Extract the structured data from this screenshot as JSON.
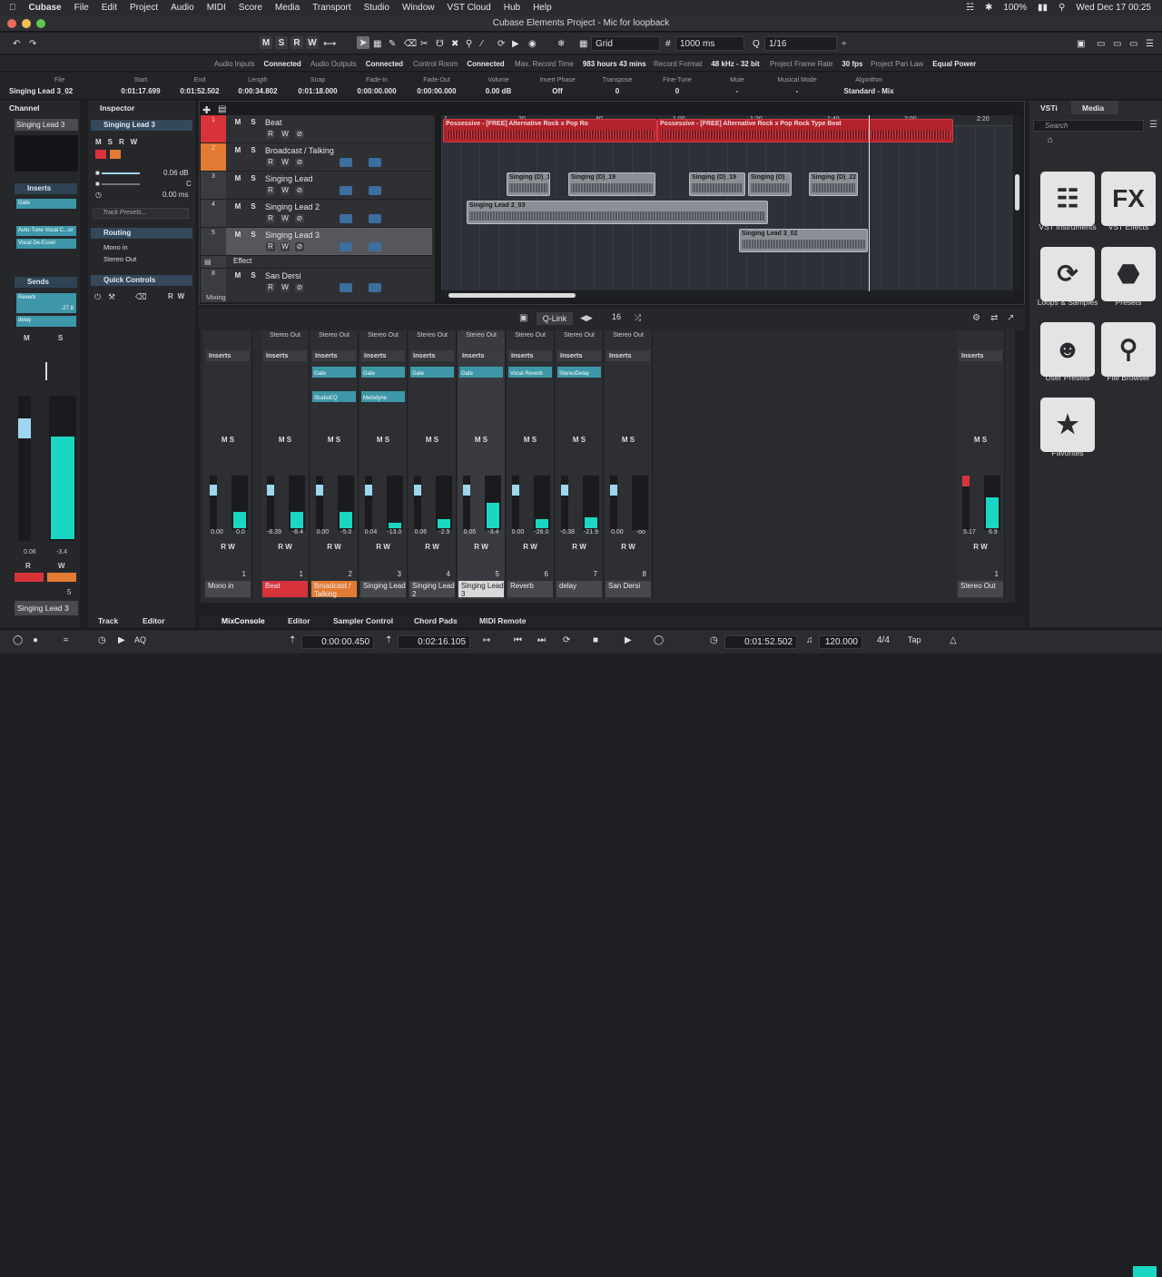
{
  "menubar": {
    "app": "Cubase",
    "items": [
      "File",
      "Edit",
      "Project",
      "Audio",
      "MIDI",
      "Score",
      "Media",
      "Transport",
      "Studio",
      "Window",
      "VST Cloud",
      "Hub",
      "Help"
    ],
    "battery": "100%",
    "clock": "Wed Dec 17  00:25"
  },
  "window": {
    "title": "Cubase Elements Project - Mic for loopback"
  },
  "toolbar": {
    "m": "M",
    "s": "S",
    "r": "R",
    "w": "W",
    "snap_type": "Grid",
    "grid_value": "1000 ms",
    "quantize": "1/16"
  },
  "status": [
    {
      "label": "Audio Inputs",
      "value": "Connected"
    },
    {
      "label": "Audio Outputs",
      "value": "Connected"
    },
    {
      "label": "Control Room",
      "value": "Connected"
    },
    {
      "label": "Max. Record Time",
      "value": "983 hours 43 mins"
    },
    {
      "label": "Record Format",
      "value": "48 kHz - 32 bit"
    },
    {
      "label": "Project Frame Rate",
      "value": "30 fps"
    },
    {
      "label": "Project Pan Law",
      "value": "Equal Power"
    }
  ],
  "info": {
    "file_label": "File",
    "file": "Singing Lead 3_02",
    "cols": [
      {
        "label": "Start",
        "value": "0:01:17.699"
      },
      {
        "label": "End",
        "value": "0:01:52.502"
      },
      {
        "label": "Length",
        "value": "0:00:34.802"
      },
      {
        "label": "Snap",
        "value": "0:01:18.000"
      },
      {
        "label": "Fade-In",
        "value": "0:00:00.000"
      },
      {
        "label": "Fade-Out",
        "value": "0:00:00.000"
      },
      {
        "label": "Volume",
        "value": "0.00     dB"
      },
      {
        "label": "Invert Phase",
        "value": "Off"
      },
      {
        "label": "Transpose",
        "value": "0"
      },
      {
        "label": "Fine-Tune",
        "value": "0"
      },
      {
        "label": "Mute",
        "value": "-"
      },
      {
        "label": "Musical Mode",
        "value": "-"
      },
      {
        "label": "Algorithm",
        "value": "Standard - Mix"
      }
    ]
  },
  "left": {
    "tab": "Channel",
    "track": "Singing Lead 3",
    "inserts": "Inserts",
    "ins1": "Gate",
    "ins2": "Auto-Tune Vocal C...or",
    "ins3": "Vocal De-Esser",
    "sends": "Sends",
    "send1": "Reverb",
    "send1_val": "-27.8",
    "send2": "delay",
    "vol": "0.06",
    "pan": "-3.4",
    "num": "5",
    "bottom": "Singing Lead 3"
  },
  "inspector": {
    "tab": "Inspector",
    "track": "Singing Lead 3",
    "vol": "0.06 dB",
    "pan": "C",
    "delay": "0.00 ms",
    "presets": "Track Presets...",
    "routing": "Routing",
    "in": "Mono in",
    "out": "Stereo Out",
    "qc": "Quick Controls"
  },
  "tracks": [
    {
      "num": "1",
      "name": "Beat",
      "color": "#d8333b"
    },
    {
      "num": "2",
      "name": "Broadcast / Talking",
      "color": "#e37b34"
    },
    {
      "num": "3",
      "name": "Singing Lead",
      "color": "#3b3c41"
    },
    {
      "num": "4",
      "name": "Singing Lead 2",
      "color": "#3b3c41"
    },
    {
      "num": "5",
      "name": "Singing Lead 3",
      "color": "#3b3c41"
    },
    {
      "num": "",
      "name": "Effect",
      "color": "#3b3c41"
    },
    {
      "num": "8",
      "name": "San Dersi",
      "color": "#3b3c41"
    }
  ],
  "track_footer": "Mixing",
  "ruler": [
    "1",
    "20",
    "40",
    "1:00",
    "1:20",
    "1:40",
    "2:00",
    "2:20"
  ],
  "events": {
    "beat1": "Possessive - [FREE] Alternative Rock x Pop Ro",
    "beat2": "Possessive - [FREE] Alternative Rock x Pop Rock Type Beat",
    "s1": "Singing (D)_1",
    "s2": "Singing (D)_19",
    "s3": "Singing (D)_19",
    "s4": "Singing (D)_",
    "s5": "Singing (D)_22",
    "sl2": "Singing Lead 2_03",
    "sl3": "Singing Lead 3_02"
  },
  "mixhdr": {
    "qlink": "Q-Link",
    "count": "16"
  },
  "strips": [
    {
      "out": "",
      "name": "Mono in",
      "num": "1",
      "l": "0.00",
      "r": "0.0",
      "nameColor": "#47484d"
    },
    {
      "out": "Stereo Out",
      "name": "Beat",
      "num": "1",
      "l": "-8.39",
      "r": "-8.4",
      "nameColor": "#d8333b"
    },
    {
      "out": "Stereo Out",
      "name": "Broadcast / Talking",
      "num": "2",
      "l": "0.00",
      "r": "-5.0",
      "nameColor": "#e37b34"
    },
    {
      "out": "Stereo Out",
      "name": "Singing Lead",
      "num": "3",
      "l": "0.04",
      "r": "-13.0",
      "nameColor": "#47484d"
    },
    {
      "out": "Stereo Out",
      "name": "Singing Lead 2",
      "num": "4",
      "l": "0.06",
      "r": "-2.9",
      "nameColor": "#47484d"
    },
    {
      "out": "Stereo Out",
      "name": "Singing Lead 3",
      "num": "5",
      "l": "0.06",
      "r": "-3.4",
      "nameColor": "#d9d9d9"
    },
    {
      "out": "Stereo Out",
      "name": "Reverb",
      "num": "6",
      "l": "0.00",
      "r": "-26.0",
      "nameColor": "#47484d"
    },
    {
      "out": "Stereo Out",
      "name": "delay",
      "num": "7",
      "l": "-0.38",
      "r": "-21.9",
      "nameColor": "#47484d"
    },
    {
      "out": "Stereo Out",
      "name": "San Dersi",
      "num": "8",
      "l": "0.00",
      "r": "-oo",
      "nameColor": "#47484d"
    }
  ],
  "master": {
    "name": "Stereo Out",
    "l": "5.17",
    "r": "6.9",
    "num": "1"
  },
  "inserts_label": "Inserts",
  "slots": {
    "a": "Gate",
    "b": "StudioEQ",
    "c": "Gate",
    "d": "Melodyne",
    "e": "Gate",
    "f": "Gate",
    "g": "Vocal Reverb",
    "h": "StereoDelay"
  },
  "bottom_tabs": {
    "track": "Track",
    "editor": "Editor",
    "mix": "MixConsole",
    "ed2": "Editor",
    "sampler": "Sampler Control",
    "chord": "Chord Pads",
    "remote": "MIDI Remote"
  },
  "transport": {
    "left": "0:00:00.450",
    "right": "0:02:16.105",
    "pos": "0:01:52.502",
    "tempo": "120.000",
    "sig": "4/4",
    "tap": "Tap",
    "aq": "AQ"
  },
  "right": {
    "tab1": "VSTi",
    "tab2": "Media",
    "search": "Search",
    "tiles": [
      "VST Instruments",
      "VST Effects",
      "Loops & Samples",
      "Presets",
      "User Presets",
      "File Browser",
      "Favorites"
    ]
  }
}
